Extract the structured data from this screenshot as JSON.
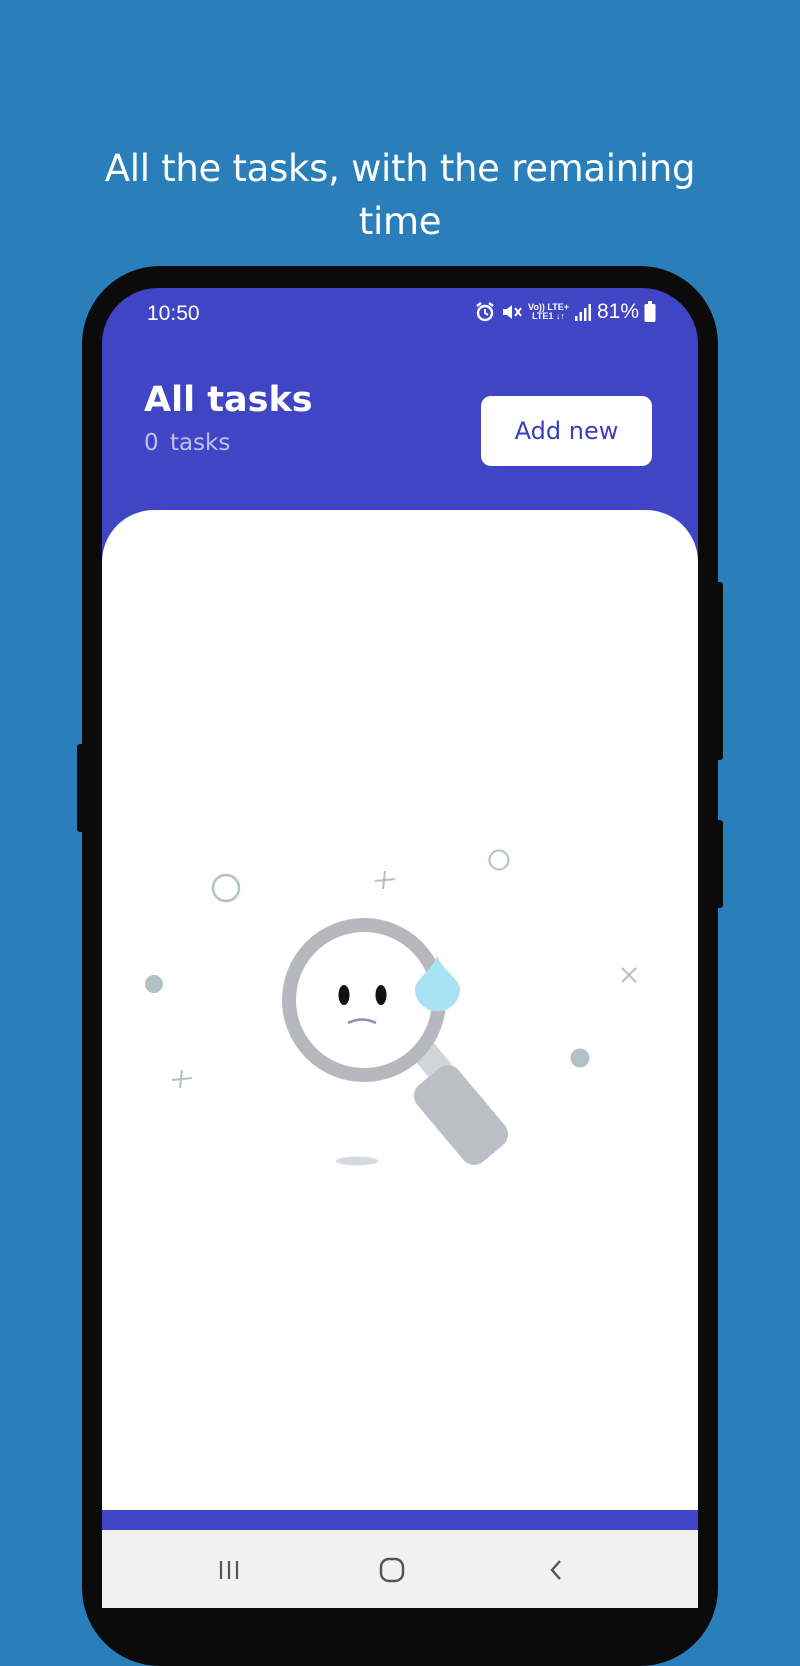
{
  "promo": {
    "line1": "All the tasks, with the remaining",
    "line2": "time"
  },
  "status_bar": {
    "time": "10:50",
    "network_top": "Vo)) LTE+",
    "network_bottom": "LTE1 ↓↑",
    "battery": "81%",
    "icons": [
      "alarm-icon",
      "mute-icon",
      "signal-icon",
      "battery-icon"
    ]
  },
  "header": {
    "title": "All tasks",
    "count_label": "0 tasks",
    "add_button": "Add new"
  },
  "empty_state": {
    "illustration": "sad-magnifier-icon"
  },
  "nav_bar": {
    "icons": [
      "recents-icon",
      "home-icon",
      "back-icon"
    ]
  },
  "colors": {
    "background": "#2A7FBA",
    "app_bar": "#4045C6",
    "button_text": "#3B3FB8",
    "content": "#FFFFFF"
  }
}
